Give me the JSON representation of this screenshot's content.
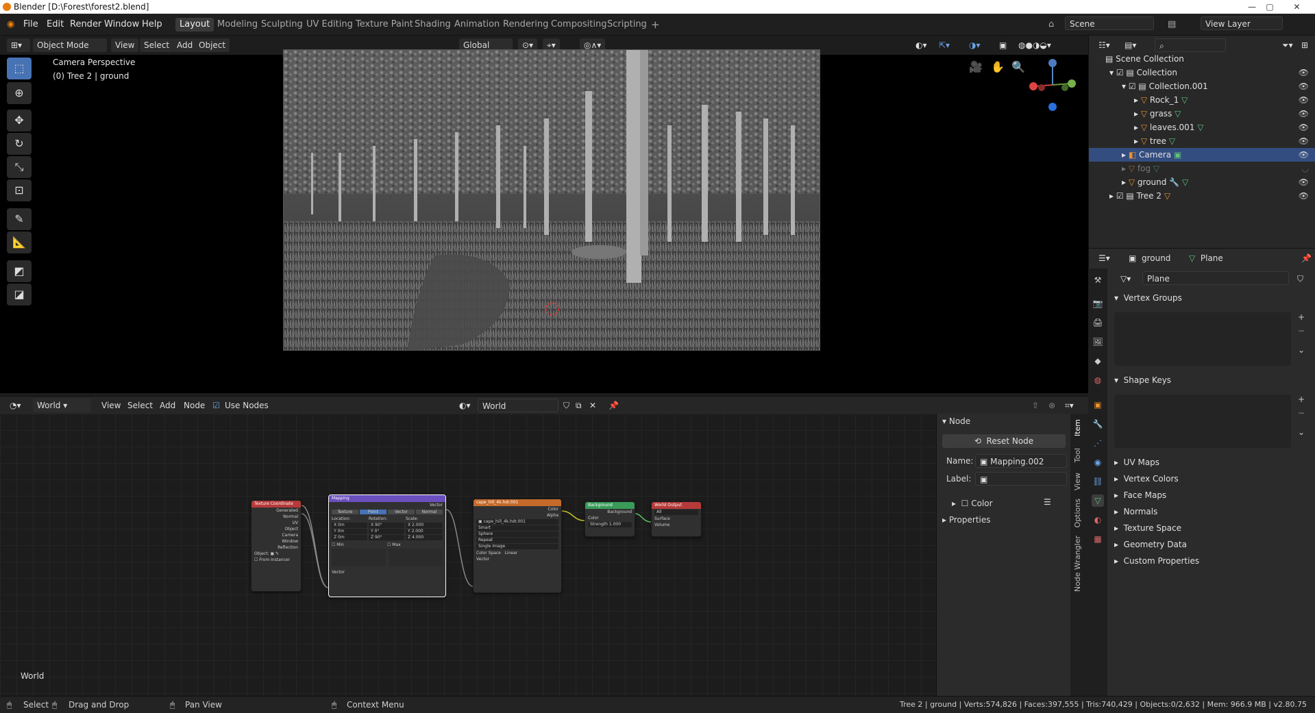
{
  "window": {
    "title": "Blender [D:\\Forest\\forest2.blend]"
  },
  "menu": {
    "file": "File",
    "edit": "Edit",
    "render": "Render",
    "window": "Window",
    "help": "Help"
  },
  "workspaces": [
    "Layout",
    "Modeling",
    "Sculpting",
    "UV Editing",
    "Texture Paint",
    "Shading",
    "Animation",
    "Rendering",
    "Compositing",
    "Scripting"
  ],
  "scene": {
    "name": "Scene",
    "view_layer": "View Layer"
  },
  "viewport_header": {
    "mode": "Object Mode",
    "view": "View",
    "select": "Select",
    "add": "Add",
    "object": "Object",
    "orientation": "Global"
  },
  "viewport": {
    "camera_label": "Camera Perspective",
    "object_label": "(0) Tree 2 | ground"
  },
  "node_editor": {
    "type": "World",
    "view": "View",
    "select": "Select",
    "add": "Add",
    "node": "Node",
    "use_nodes": "Use Nodes",
    "world_name": "World",
    "corner_label": "World",
    "nodes": {
      "texcoord": {
        "title": "Texture Coordinate",
        "outputs": [
          "Generated",
          "Normal",
          "UV",
          "Object",
          "Camera",
          "Window",
          "Reflection"
        ],
        "object_label": "Object:",
        "from_instancer": "From Instancer"
      },
      "mapping": {
        "title": "Mapping",
        "output": "Vector",
        "tabs": [
          "Texture",
          "Point",
          "Vector",
          "Normal"
        ],
        "cols": [
          "Location:",
          "Rotation:",
          "Scale:"
        ],
        "loc": [
          "X 0m",
          "Y 0m",
          "Z 0m"
        ],
        "rot": [
          "X 90°",
          "Y 0°",
          "Z 90°"
        ],
        "scale": [
          "X 2.000",
          "Y 2.000",
          "Z 4.000"
        ],
        "min": "Min",
        "max": "Max",
        "input": "Vector"
      },
      "envtex": {
        "title": "cape_hill_4k.hdr.001",
        "outputs": [
          "Color",
          "Alpha"
        ],
        "image": "cape_hill_4k.hdr.001",
        "options": [
          "Smart",
          "Sphere",
          "Repeat",
          "Single Image"
        ],
        "color_space_label": "Color Space",
        "color_space": "Linear",
        "input": "Vector"
      },
      "background": {
        "title": "Background",
        "output": "Background",
        "color": "Color",
        "strength": "Strength",
        "strength_val": "1.000"
      },
      "worldout": {
        "title": "World Output",
        "target": "All",
        "inputs": [
          "Surface",
          "Volume"
        ]
      }
    }
  },
  "node_panel": {
    "section": "Node",
    "reset": "Reset Node",
    "name_label": "Name:",
    "name_value": "Mapping.002",
    "label_label": "Label:",
    "label_value": "",
    "color": "Color",
    "properties": "Properties",
    "tabs": [
      "Item",
      "Tool",
      "View",
      "Options",
      "Node Wrangler"
    ]
  },
  "outliner": {
    "scene_collection": "Scene Collection",
    "rows": [
      "Collection",
      "Collection.001",
      "Rock_1",
      "grass",
      "leaves.001",
      "tree",
      "Camera",
      "fog",
      "ground",
      "Tree 2"
    ]
  },
  "properties": {
    "object_name": "ground",
    "mesh_name": "Plane",
    "data_name": "Plane",
    "sections": [
      "Vertex Groups",
      "Shape Keys",
      "UV Maps",
      "Vertex Colors",
      "Face Maps",
      "Normals",
      "Texture Space",
      "Geometry Data",
      "Custom Properties"
    ]
  },
  "statusbar": {
    "select": "Select",
    "drag": "Drag and Drop",
    "pan": "Pan View",
    "context": "Context Menu",
    "stats": "Tree 2 | ground | Verts:574,826 | Faces:397,555 | Tris:740,429 | Objects:0/2,632 | Mem: 966.9 MB | v2.80.75"
  },
  "colors": {
    "accent": "#4772b3",
    "selection": "#334d80",
    "orange": "#e87d0d"
  }
}
